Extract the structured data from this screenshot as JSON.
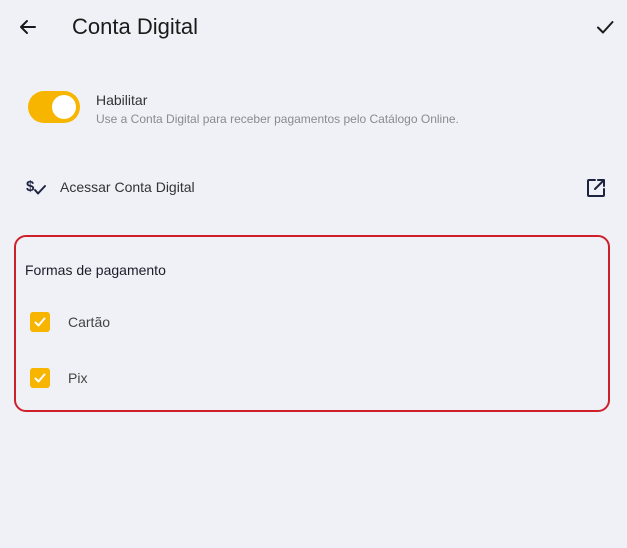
{
  "header": {
    "title": "Conta Digital",
    "back_icon": "arrow-left-icon",
    "confirm_icon": "check-icon"
  },
  "enable": {
    "label": "Habilitar",
    "description": "Use a Conta Digital para receber pagamentos pelo Catálogo Online.",
    "enabled": true
  },
  "access": {
    "label": "Acessar Conta Digital",
    "icon": "dollar-check-icon",
    "action_icon": "external-link-icon"
  },
  "payment_methods": {
    "title": "Formas de pagamento",
    "items": [
      {
        "label": "Cartão",
        "checked": true
      },
      {
        "label": "Pix",
        "checked": true
      }
    ]
  },
  "colors": {
    "accent": "#f7b500",
    "highlight_border": "#cf1f2a",
    "background": "#f0f1f6"
  }
}
